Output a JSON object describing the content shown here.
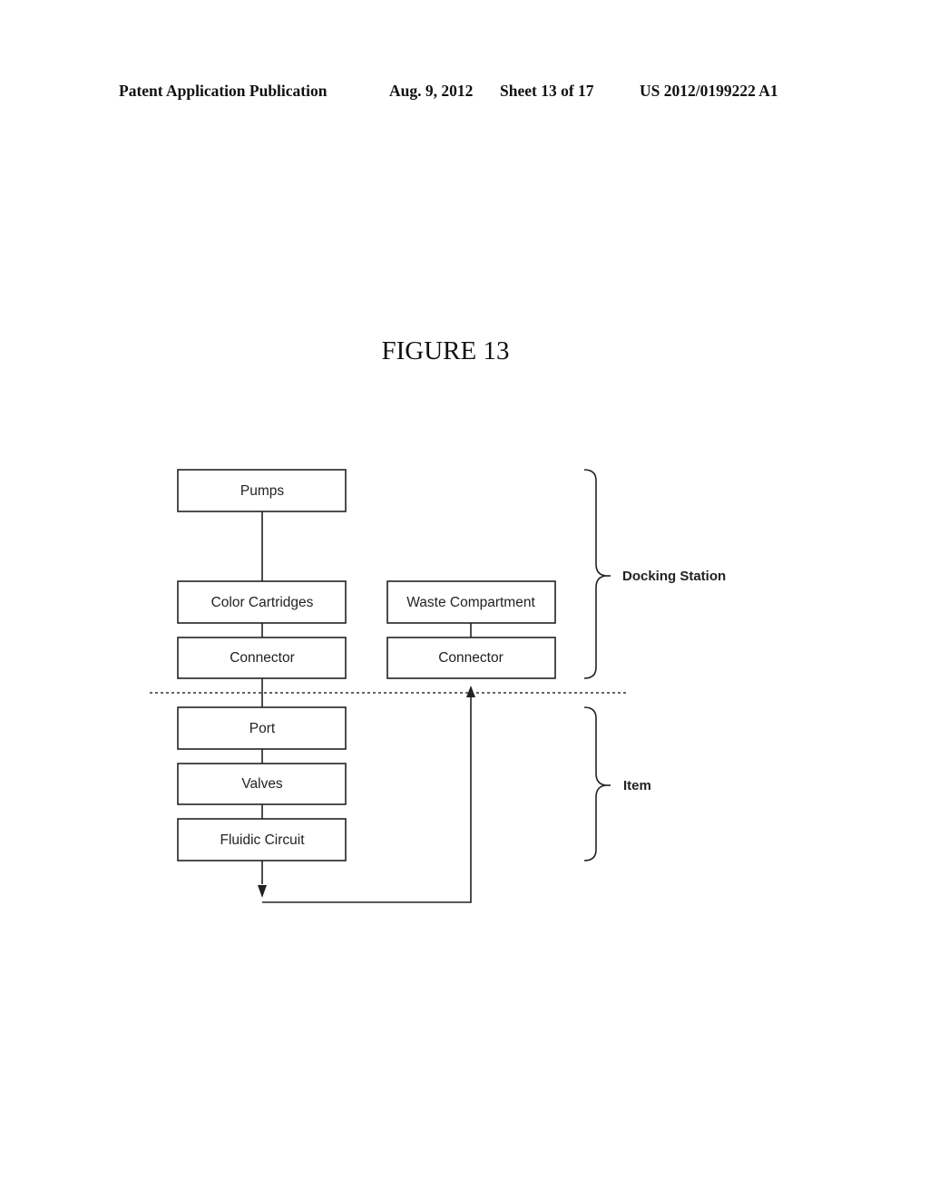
{
  "header": {
    "publication": "Patent Application Publication",
    "date": "Aug. 9, 2012",
    "sheet": "Sheet 13 of 17",
    "number": "US 2012/0199222 A1"
  },
  "figure": {
    "title": "FIGURE 13"
  },
  "diagram": {
    "boxes": {
      "pumps": "Pumps",
      "color_cartridges": "Color Cartridges",
      "connector_left": "Connector",
      "waste_compartment": "Waste Compartment",
      "connector_right": "Connector",
      "port": "Port",
      "valves": "Valves",
      "fluidic_circuit": "Fluidic Circuit"
    },
    "groups": {
      "docking_station": "Docking Station",
      "item": "Item"
    },
    "edges": [
      {
        "from": "pumps",
        "to": "color_cartridges"
      },
      {
        "from": "color_cartridges",
        "to": "connector_left"
      },
      {
        "from": "connector_left",
        "to": "port"
      },
      {
        "from": "port",
        "to": "valves"
      },
      {
        "from": "valves",
        "to": "fluidic_circuit"
      },
      {
        "from": "fluidic_circuit",
        "to": "connector_right",
        "arrow": true
      },
      {
        "from": "waste_compartment",
        "to": "connector_right"
      }
    ]
  }
}
